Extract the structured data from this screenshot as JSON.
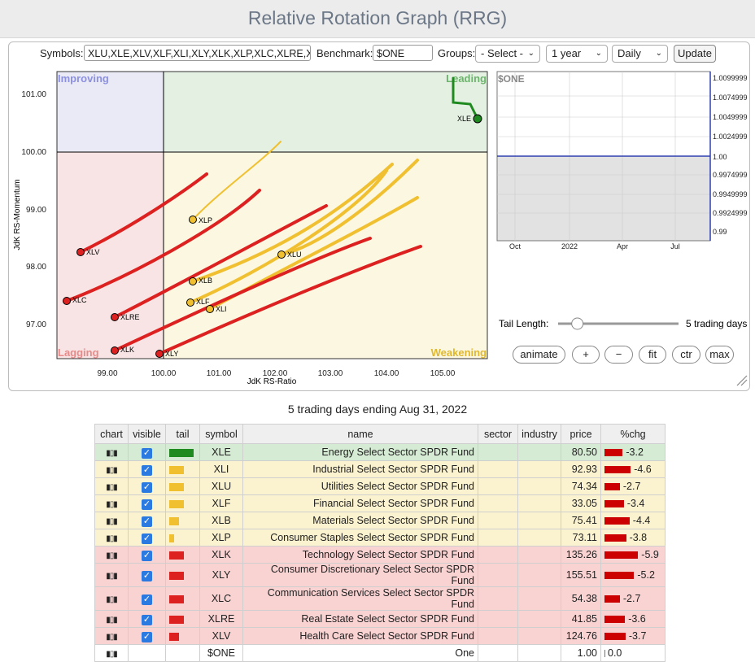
{
  "title": "Relative Rotation Graph (RRG)",
  "controls": {
    "symbols_label": "Symbols:",
    "symbols_value": "XLU,XLE,XLV,XLF,XLI,XLY,XLK,XLP,XLC,XLRE,XLB",
    "benchmark_label": "Benchmark:",
    "benchmark_value": "$ONE",
    "groups_label": "Groups:",
    "groups_value": "- Select -",
    "period_value": "1 year",
    "interval_value": "Daily",
    "update_label": "Update"
  },
  "rrg": {
    "x_label": "JdK RS-Ratio",
    "y_label": "JdK RS-Momentum",
    "x_ticks": [
      "99.00",
      "100.00",
      "101.00",
      "102.00",
      "103.00",
      "104.00",
      "105.00"
    ],
    "y_ticks": [
      "101.00",
      "100.00",
      "99.00",
      "98.00",
      "97.00"
    ],
    "quadrants": {
      "improving": "Improving",
      "leading": "Leading",
      "lagging": "Lagging",
      "weakening": "Weakening"
    },
    "points": [
      {
        "sym": "XLE",
        "label": "XLE",
        "color": "green"
      },
      {
        "sym": "XLP",
        "label": "XLP",
        "color": "yellow"
      },
      {
        "sym": "XLU",
        "label": "XLU",
        "color": "yellow"
      },
      {
        "sym": "XLB",
        "label": "XLB",
        "color": "yellow"
      },
      {
        "sym": "XLF",
        "label": "XLF",
        "color": "yellow"
      },
      {
        "sym": "XLI",
        "label": "XLI",
        "color": "yellow"
      },
      {
        "sym": "XLV",
        "label": "XLV",
        "color": "red"
      },
      {
        "sym": "XLC",
        "label": "XLC",
        "color": "red"
      },
      {
        "sym": "XLRE",
        "label": "XLRE",
        "color": "red"
      },
      {
        "sym": "XLK",
        "label": "XLK",
        "color": "red"
      },
      {
        "sym": "XLY",
        "label": "XLY",
        "color": "red"
      }
    ]
  },
  "price_chart": {
    "symbol": "$ONE",
    "x_ticks": [
      "Oct",
      "2022",
      "Apr",
      "Jul"
    ],
    "y_ticks": [
      "1.0099999",
      "1.0074999",
      "1.0049999",
      "1.0024999",
      "1.00",
      "0.9974999",
      "0.9949999",
      "0.9924999",
      "0.99"
    ]
  },
  "tail": {
    "label": "Tail Length:",
    "value_text": "5 trading days",
    "slider_fraction": 0.16
  },
  "buttons": {
    "animate": "animate",
    "plus": "+",
    "minus": "−",
    "fit": "fit",
    "ctr": "ctr",
    "max": "max"
  },
  "caption": "5 trading days ending Aug 31, 2022",
  "table": {
    "headers": [
      "chart",
      "visible",
      "tail",
      "symbol",
      "name",
      "sector",
      "industry",
      "price",
      "%chg"
    ],
    "rows": [
      {
        "symbol": "XLE",
        "name": "Energy Select Sector SPDR Fund",
        "price": "80.50",
        "chg": "-3.2",
        "chg_value": -3.2,
        "tail_value": 5,
        "zone": "green"
      },
      {
        "symbol": "XLI",
        "name": "Industrial Select Sector SPDR Fund",
        "price": "92.93",
        "chg": "-4.6",
        "chg_value": -4.6,
        "tail_value": 3,
        "zone": "yellow"
      },
      {
        "symbol": "XLU",
        "name": "Utilities Select Sector SPDR Fund",
        "price": "74.34",
        "chg": "-2.7",
        "chg_value": -2.7,
        "tail_value": 3,
        "zone": "yellow"
      },
      {
        "symbol": "XLF",
        "name": "Financial Select Sector SPDR Fund",
        "price": "33.05",
        "chg": "-3.4",
        "chg_value": -3.4,
        "tail_value": 3,
        "zone": "yellow"
      },
      {
        "symbol": "XLB",
        "name": "Materials Select Sector SPDR Fund",
        "price": "75.41",
        "chg": "-4.4",
        "chg_value": -4.4,
        "tail_value": 2,
        "zone": "yellow"
      },
      {
        "symbol": "XLP",
        "name": "Consumer Staples Select Sector SPDR Fund",
        "price": "73.11",
        "chg": "-3.8",
        "chg_value": -3.8,
        "tail_value": 1,
        "zone": "yellow"
      },
      {
        "symbol": "XLK",
        "name": "Technology Select Sector SPDR Fund",
        "price": "135.26",
        "chg": "-5.9",
        "chg_value": -5.9,
        "tail_value": 3,
        "zone": "red"
      },
      {
        "symbol": "XLY",
        "name": "Consumer Discretionary Select Sector SPDR Fund",
        "price": "155.51",
        "chg": "-5.2",
        "chg_value": -5.2,
        "tail_value": 3,
        "zone": "red"
      },
      {
        "symbol": "XLC",
        "name": "Communication Services Select Sector SPDR Fund",
        "price": "54.38",
        "chg": "-2.7",
        "chg_value": -2.7,
        "tail_value": 3,
        "zone": "red"
      },
      {
        "symbol": "XLRE",
        "name": "Real Estate Select Sector SPDR Fund",
        "price": "41.85",
        "chg": "-3.6",
        "chg_value": -3.6,
        "tail_value": 3,
        "zone": "red"
      },
      {
        "symbol": "XLV",
        "name": "Health Care Select Sector SPDR Fund",
        "price": "124.76",
        "chg": "-3.7",
        "chg_value": -3.7,
        "tail_value": 2,
        "zone": "red"
      }
    ],
    "bench_row": {
      "symbol": "$ONE",
      "name": "One",
      "price": "1.00",
      "chg": "0.0"
    }
  },
  "colors": {
    "green": "#1f8a1f",
    "yellow": "#f0c030",
    "red": "#dd2020",
    "row_green": "#d5ebd3",
    "row_yellow": "#fbf2cf",
    "row_red": "#f9d2d2"
  }
}
